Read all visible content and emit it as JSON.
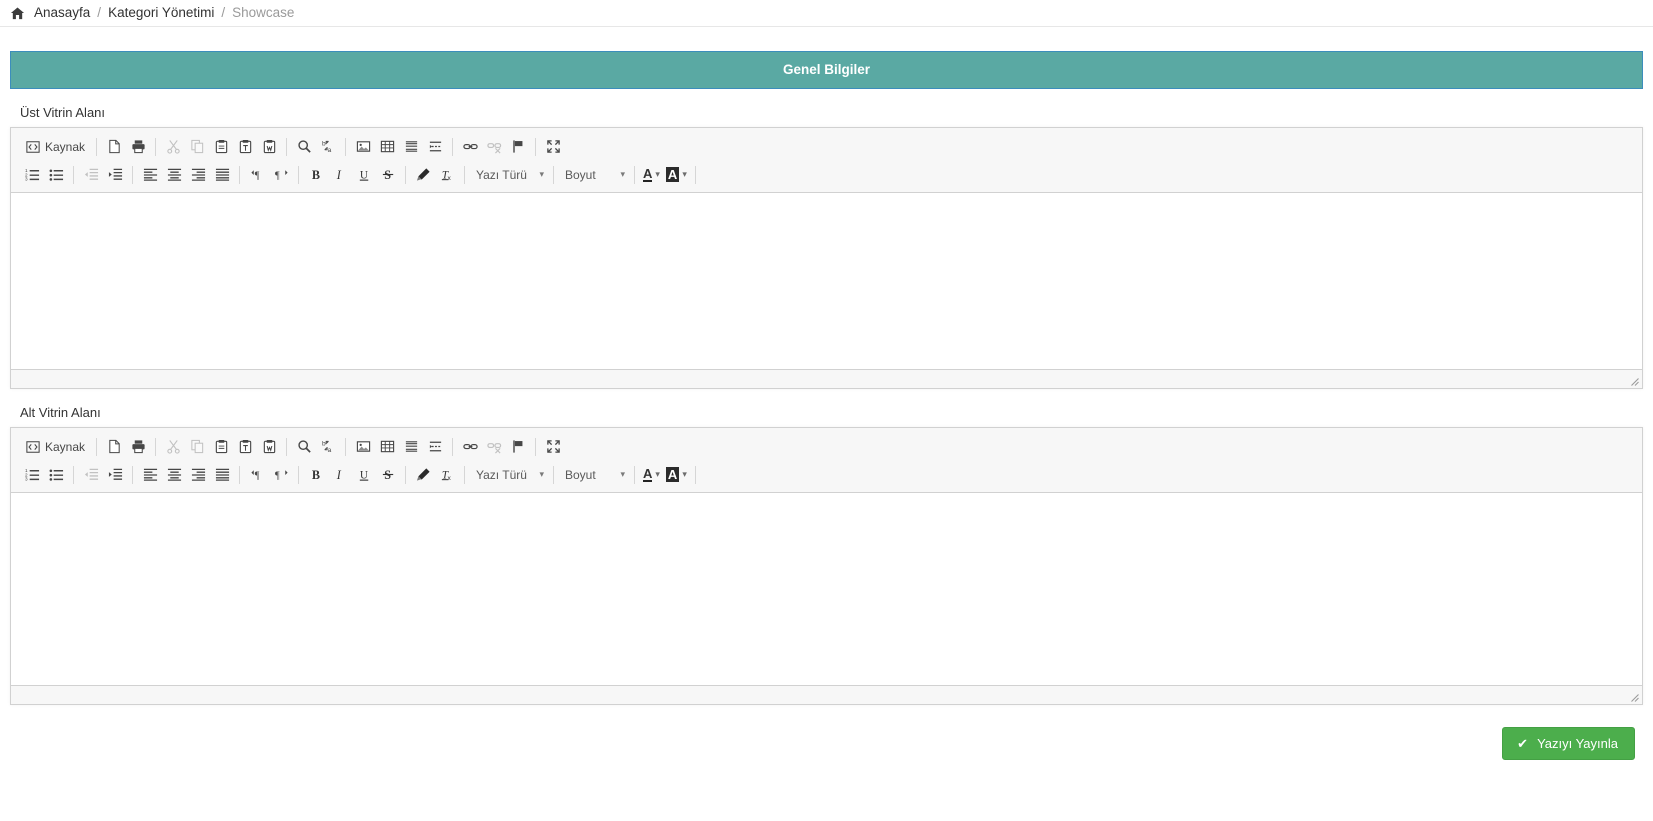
{
  "breadcrumb": {
    "home_icon": "home-icon",
    "items": [
      {
        "label": "Anasayfa",
        "active": false
      },
      {
        "label": "Kategori Yönetimi",
        "active": false
      },
      {
        "label": "Showcase",
        "active": true
      }
    ],
    "separator": "/"
  },
  "panel": {
    "heading": "Genel Bilgiler",
    "heading_bg": "#5aa9a3",
    "heading_border": "#3c8dbc"
  },
  "editors": [
    {
      "label": "Üst Vitrin Alanı",
      "content": "",
      "toolbar": {
        "source_label": "Kaynak",
        "font_label": "Yazı Türü",
        "size_label": "Boyut",
        "caret": "▾"
      }
    },
    {
      "label": "Alt Vitrin Alanı",
      "content": "",
      "toolbar": {
        "source_label": "Kaynak",
        "font_label": "Yazı Türü",
        "size_label": "Boyut",
        "caret": "▾"
      }
    }
  ],
  "footer": {
    "publish_label": "Yazıyı Yayınla",
    "publish_check": "✔",
    "publish_color": "#4cae4c"
  }
}
